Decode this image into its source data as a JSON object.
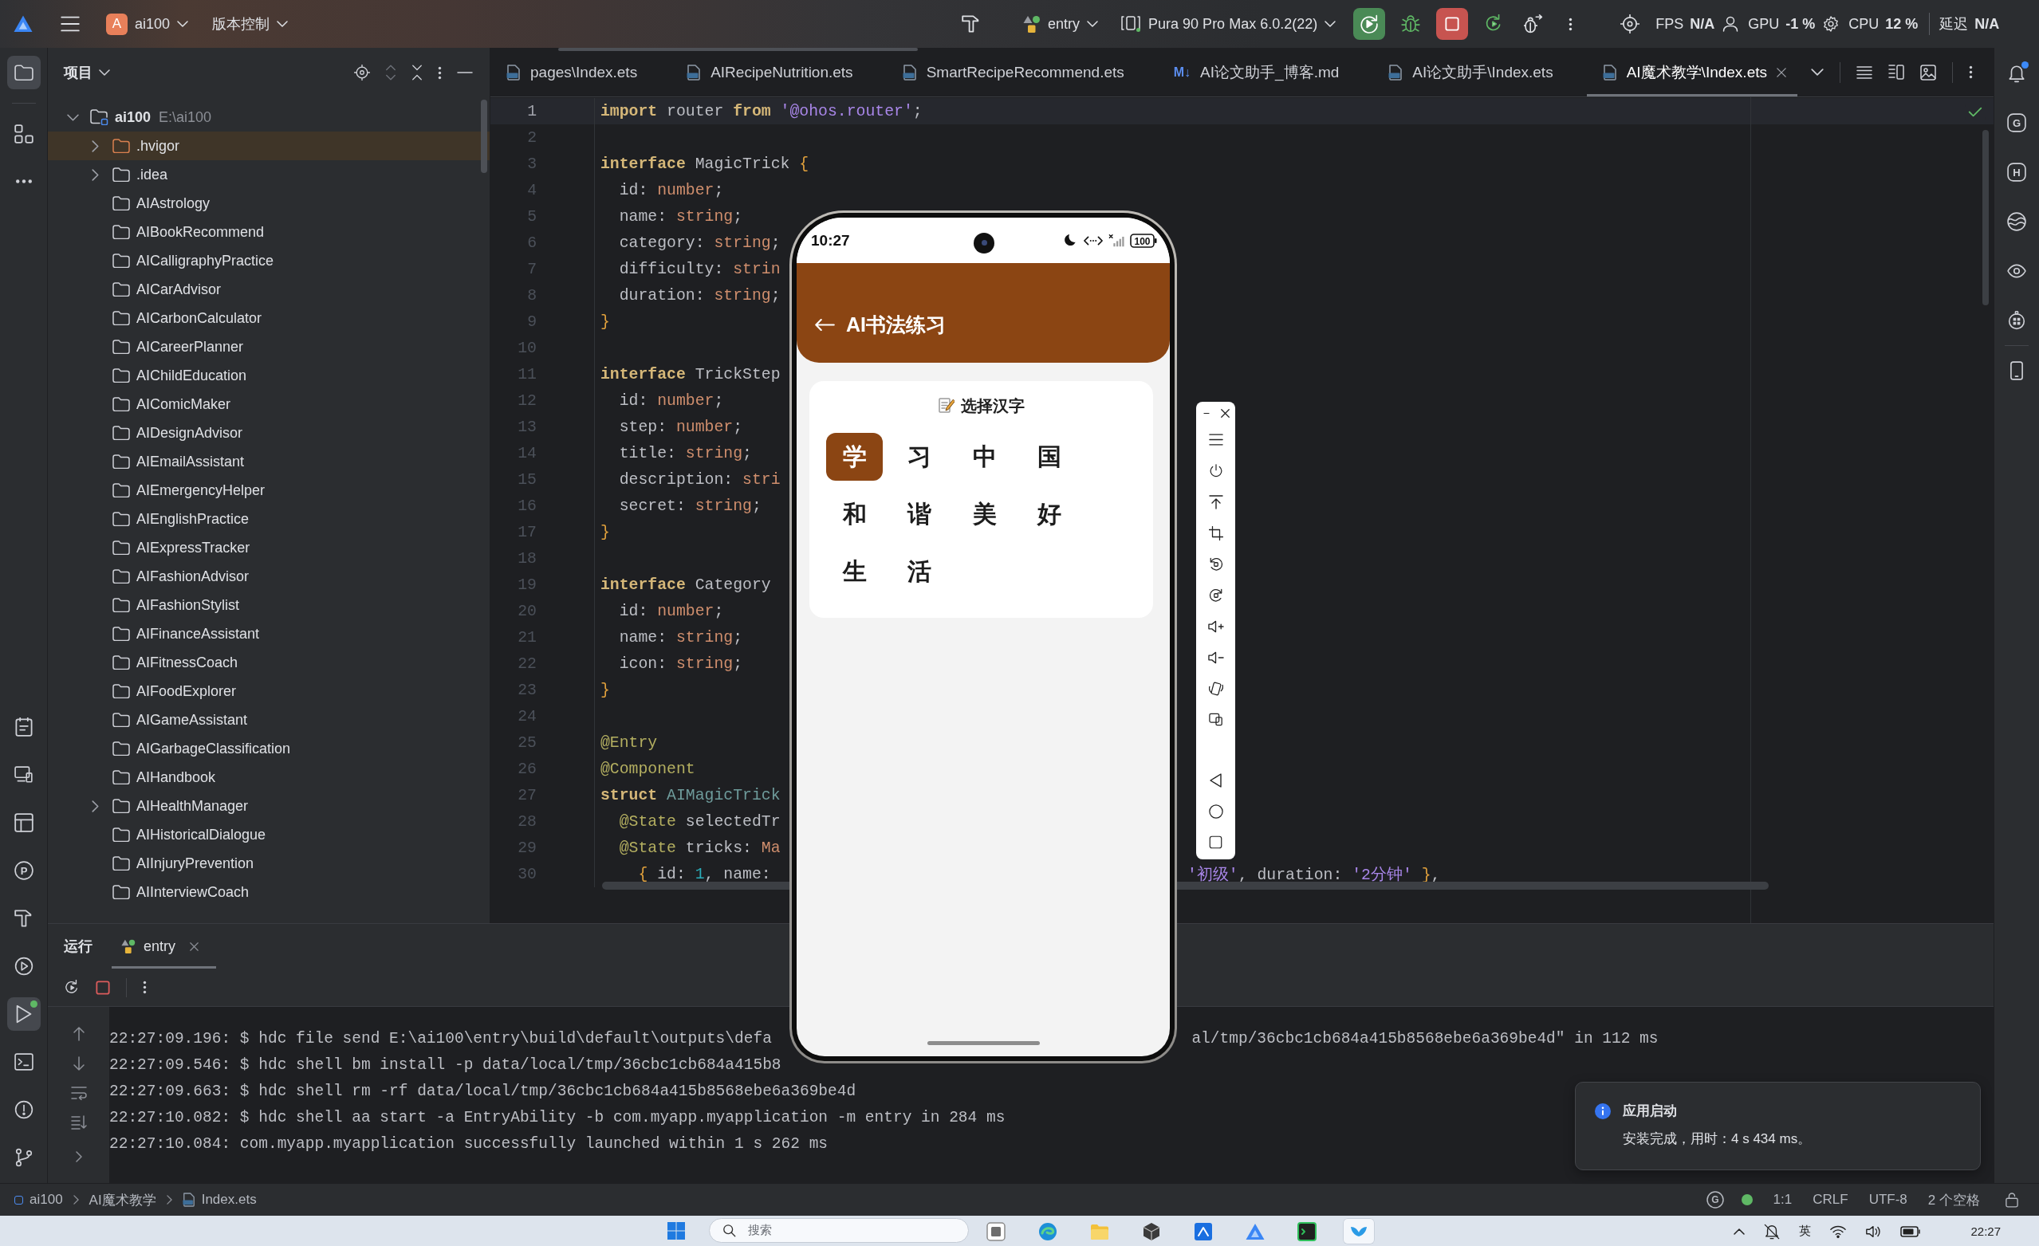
{
  "title_bar": {
    "project_badge": "A",
    "project_name": "ai100",
    "vcs_menu": "版本控制",
    "run_config": "entry",
    "device": "Pura 90 Pro Max 6.0.2(22)",
    "metrics": [
      {
        "label": "FPS",
        "value": "N/A"
      },
      {
        "label": "GPU",
        "value": "-1 %"
      },
      {
        "label": "CPU",
        "value": "12 %"
      },
      {
        "label": "延迟",
        "value": "N/A"
      }
    ]
  },
  "activity_bar": {
    "top": [
      {
        "kind": "project",
        "selected": true
      },
      {
        "kind": "structure",
        "selected": false
      },
      {
        "kind": "more",
        "selected": false
      }
    ],
    "bottom": [
      {
        "kind": "todo",
        "selected": false,
        "running": false
      },
      {
        "kind": "devices",
        "selected": false,
        "running": false
      },
      {
        "kind": "layout",
        "selected": false,
        "running": false
      },
      {
        "kind": "letter",
        "glyph": "P",
        "selected": false,
        "running": false
      },
      {
        "kind": "build",
        "selected": false,
        "running": false
      },
      {
        "kind": "services",
        "selected": false,
        "running": false
      },
      {
        "kind": "run",
        "selected": true,
        "running": true
      },
      {
        "kind": "terminal",
        "selected": false,
        "running": false
      },
      {
        "kind": "problems",
        "selected": false,
        "running": false
      },
      {
        "kind": "git",
        "selected": false,
        "running": false
      }
    ]
  },
  "project_panel": {
    "title": "项目",
    "tree": [
      {
        "name": "ai100",
        "path": "E:\\ai100",
        "kind": "module",
        "expanded": true,
        "selected": false,
        "children": [
          {
            "name": ".hvigor",
            "kind": "excluded",
            "expanded": false,
            "selected": true
          },
          {
            "name": ".idea",
            "kind": "folder",
            "expanded": false,
            "selected": false
          },
          {
            "name": "AIAstrology",
            "kind": "folder",
            "selected": false
          },
          {
            "name": "AIBookRecommend",
            "kind": "folder",
            "selected": false
          },
          {
            "name": "AICalligraphyPractice",
            "kind": "folder",
            "selected": false
          },
          {
            "name": "AICarAdvisor",
            "kind": "folder",
            "selected": false
          },
          {
            "name": "AICarbonCalculator",
            "kind": "folder",
            "selected": false
          },
          {
            "name": "AICareerPlanner",
            "kind": "folder",
            "selected": false
          },
          {
            "name": "AIChildEducation",
            "kind": "folder",
            "selected": false
          },
          {
            "name": "AIComicMaker",
            "kind": "folder",
            "selected": false
          },
          {
            "name": "AIDesignAdvisor",
            "kind": "folder",
            "selected": false
          },
          {
            "name": "AIEmailAssistant",
            "kind": "folder",
            "selected": false
          },
          {
            "name": "AIEmergencyHelper",
            "kind": "folder",
            "selected": false
          },
          {
            "name": "AIEnglishPractice",
            "kind": "folder",
            "selected": false
          },
          {
            "name": "AIExpressTracker",
            "kind": "folder",
            "selected": false
          },
          {
            "name": "AIFashionAdvisor",
            "kind": "folder",
            "selected": false
          },
          {
            "name": "AIFashionStylist",
            "kind": "folder",
            "selected": false
          },
          {
            "name": "AIFinanceAssistant",
            "kind": "folder",
            "selected": false
          },
          {
            "name": "AIFitnessCoach",
            "kind": "folder",
            "selected": false
          },
          {
            "name": "AIFoodExplorer",
            "kind": "folder",
            "selected": false
          },
          {
            "name": "AIGameAssistant",
            "kind": "folder",
            "selected": false
          },
          {
            "name": "AIGarbageClassification",
            "kind": "folder",
            "selected": false
          },
          {
            "name": "AIHandbook",
            "kind": "folder",
            "selected": false
          },
          {
            "name": "AIHealthManager",
            "kind": "folder",
            "expanded": false,
            "selected": false
          },
          {
            "name": "AIHistoricalDialogue",
            "kind": "folder",
            "selected": false
          },
          {
            "name": "AIInjuryPrevention",
            "kind": "folder",
            "selected": false
          },
          {
            "name": "AIInterviewCoach",
            "kind": "folder",
            "selected": false
          }
        ]
      }
    ]
  },
  "editor": {
    "tabs": [
      {
        "label": "pages\\Index.ets",
        "kind": "ets",
        "selected": false
      },
      {
        "label": "AIRecipeNutrition.ets",
        "kind": "ets",
        "selected": false
      },
      {
        "label": "SmartRecipeRecommend.ets",
        "kind": "ets",
        "selected": false
      },
      {
        "label": "AI论文助手_博客.md",
        "kind": "md",
        "icon_text": "M↓",
        "selected": false
      },
      {
        "label": "AI论文助手\\Index.ets",
        "kind": "ets",
        "selected": false
      },
      {
        "label": "AI魔术教学\\Index.ets",
        "kind": "ets",
        "selected": true
      }
    ],
    "no_problems": true,
    "lines": [
      {
        "number": "1",
        "current": true,
        "tokens": [
          {
            "kind": "kw",
            "text": "import"
          },
          {
            "kind": "plain",
            "text": " router "
          },
          {
            "kind": "kw",
            "text": "from"
          },
          {
            "kind": "str",
            "text": " '@ohos.router'"
          },
          {
            "kind": "plain",
            "text": ";"
          }
        ]
      },
      {
        "number": "2",
        "current": false
      },
      {
        "number": "3",
        "current": false,
        "tokens": [
          {
            "kind": "kw",
            "text": "interface"
          },
          {
            "kind": "cls",
            "text": " MagicTrick"
          },
          {
            "kind": "brace",
            "text": " {"
          }
        ]
      },
      {
        "number": "4",
        "current": false,
        "tokens": [
          {
            "kind": "plain",
            "text": "  id: "
          },
          {
            "kind": "type",
            "text": "number"
          },
          {
            "kind": "plain",
            "text": ";"
          }
        ]
      },
      {
        "number": "5",
        "current": false,
        "tokens": [
          {
            "kind": "plain",
            "text": "  name: "
          },
          {
            "kind": "type",
            "text": "string"
          },
          {
            "kind": "plain",
            "text": ";"
          }
        ]
      },
      {
        "number": "6",
        "current": false,
        "tokens": [
          {
            "kind": "plain",
            "text": "  category: "
          },
          {
            "kind": "type",
            "text": "string"
          },
          {
            "kind": "plain",
            "text": ";"
          }
        ]
      },
      {
        "number": "7",
        "current": false,
        "tokens": [
          {
            "kind": "plain",
            "text": "  difficulty: "
          },
          {
            "kind": "type",
            "text": "strin"
          }
        ]
      },
      {
        "number": "8",
        "current": false,
        "tokens": [
          {
            "kind": "plain",
            "text": "  duration: "
          },
          {
            "kind": "type",
            "text": "string"
          },
          {
            "kind": "plain",
            "text": ";"
          }
        ]
      },
      {
        "number": "9",
        "current": false,
        "tokens": [
          {
            "kind": "brace",
            "text": "}"
          }
        ]
      },
      {
        "number": "10",
        "current": false
      },
      {
        "number": "11",
        "current": false,
        "tokens": [
          {
            "kind": "kw",
            "text": "interface"
          },
          {
            "kind": "cls",
            "text": " TrickStep"
          }
        ]
      },
      {
        "number": "12",
        "current": false,
        "tokens": [
          {
            "kind": "plain",
            "text": "  id: "
          },
          {
            "kind": "type",
            "text": "number"
          },
          {
            "kind": "plain",
            "text": ";"
          }
        ]
      },
      {
        "number": "13",
        "current": false,
        "tokens": [
          {
            "kind": "plain",
            "text": "  step: "
          },
          {
            "kind": "type",
            "text": "number"
          },
          {
            "kind": "plain",
            "text": ";"
          }
        ]
      },
      {
        "number": "14",
        "current": false,
        "tokens": [
          {
            "kind": "plain",
            "text": "  title: "
          },
          {
            "kind": "type",
            "text": "string"
          },
          {
            "kind": "plain",
            "text": ";"
          }
        ]
      },
      {
        "number": "15",
        "current": false,
        "tokens": [
          {
            "kind": "plain",
            "text": "  description: "
          },
          {
            "kind": "type",
            "text": "stri"
          }
        ]
      },
      {
        "number": "16",
        "current": false,
        "tokens": [
          {
            "kind": "plain",
            "text": "  secret: "
          },
          {
            "kind": "type",
            "text": "string"
          },
          {
            "kind": "plain",
            "text": ";"
          }
        ]
      },
      {
        "number": "17",
        "current": false,
        "tokens": [
          {
            "kind": "brace",
            "text": "}"
          }
        ]
      },
      {
        "number": "18",
        "current": false
      },
      {
        "number": "19",
        "current": false,
        "tokens": [
          {
            "kind": "kw",
            "text": "interface"
          },
          {
            "kind": "cls",
            "text": " Category"
          }
        ]
      },
      {
        "number": "20",
        "current": false,
        "tokens": [
          {
            "kind": "plain",
            "text": "  id: "
          },
          {
            "kind": "type",
            "text": "number"
          },
          {
            "kind": "plain",
            "text": ";"
          }
        ]
      },
      {
        "number": "21",
        "current": false,
        "tokens": [
          {
            "kind": "plain",
            "text": "  name: "
          },
          {
            "kind": "type",
            "text": "string"
          },
          {
            "kind": "plain",
            "text": ";"
          }
        ]
      },
      {
        "number": "22",
        "current": false,
        "tokens": [
          {
            "kind": "plain",
            "text": "  icon: "
          },
          {
            "kind": "type",
            "text": "string"
          },
          {
            "kind": "plain",
            "text": ";"
          }
        ]
      },
      {
        "number": "23",
        "current": false,
        "tokens": [
          {
            "kind": "brace",
            "text": "}"
          }
        ]
      },
      {
        "number": "24",
        "current": false
      },
      {
        "number": "25",
        "current": false,
        "tokens": [
          {
            "kind": "deco",
            "text": "@Entry"
          }
        ]
      },
      {
        "number": "26",
        "current": false,
        "tokens": [
          {
            "kind": "deco",
            "text": "@Component"
          }
        ]
      },
      {
        "number": "27",
        "current": false,
        "tokens": [
          {
            "kind": "kw",
            "text": "struct"
          },
          {
            "kind": "struct",
            "text": " AIMagicTrick"
          }
        ]
      },
      {
        "number": "28",
        "current": false,
        "tokens": [
          {
            "kind": "deco",
            "text": "  @State"
          },
          {
            "kind": "plain",
            "text": " selectedTr"
          }
        ]
      },
      {
        "number": "29",
        "current": false,
        "tokens": [
          {
            "kind": "deco",
            "text": "  @State"
          },
          {
            "kind": "plain",
            "text": " tricks: "
          },
          {
            "kind": "type",
            "text": "Ma"
          }
        ]
      },
      {
        "number": "30",
        "current": false,
        "tokens": [
          {
            "kind": "brace",
            "text": "    {"
          },
          {
            "kind": "plain",
            "text": " id: "
          },
          {
            "kind": "num",
            "text": "1"
          },
          {
            "kind": "plain",
            "text": ", name:"
          }
        ],
        "visible_end": [
          {
            "kind": "str",
            "text": "'初级'"
          },
          {
            "kind": "plain",
            "text": ", duration: "
          },
          {
            "kind": "str",
            "text": "'2分钟'"
          },
          {
            "kind": "brace",
            "text": " }"
          },
          {
            "kind": "plain",
            "text": ","
          }
        ]
      }
    ]
  },
  "right_bar": {
    "items": [
      {
        "kind": "bell",
        "badge": true
      },
      {
        "kind": "letter",
        "glyph": "G",
        "badge": false
      },
      {
        "kind": "letter",
        "glyph": "H",
        "badge": false
      },
      {
        "kind": "wave",
        "badge": false
      },
      {
        "kind": "eye",
        "badge": false
      },
      {
        "kind": "robot",
        "badge": false
      },
      {
        "kind": "phone",
        "badge": false
      }
    ]
  },
  "run_panel": {
    "title": "运行",
    "tabs": [
      {
        "label": "entry",
        "selected": true
      }
    ],
    "log": [
      {
        "text": "22:27:09.196: $ hdc file send E:\\ai100\\entry\\build\\default\\outputs\\defa",
        "visible_end": "al/tmp/36cbc1cb684a415b8568ebe6a369be4d\" in 112 ms"
      },
      {
        "text": "22:27:09.546: $ hdc shell bm install -p data/local/tmp/36cbc1cb684a415b8"
      },
      {
        "text": "22:27:09.663: $ hdc shell rm -rf data/local/tmp/36cbc1cb684a415b8568ebe6a369be4d"
      },
      {
        "text": "22:27:10.082: $ hdc shell aa start -a EntryAbility -b com.myapp.myapplication -m entry in 284 ms"
      },
      {
        "text": "22:27:10.084: com.myapp.myapplication successfully launched within 1 s 262 ms"
      }
    ]
  },
  "notification": {
    "title": "应用启动",
    "message": "安装完成，用时：4 s 434 ms。"
  },
  "status_bar": {
    "breadcrumbs": [
      {
        "label": "ai100",
        "kind": "module"
      },
      {
        "label": "AI魔术教学",
        "kind": "plain"
      },
      {
        "label": "Index.ets",
        "kind": "ets"
      }
    ],
    "widget_glyph": "G",
    "connected": true,
    "items": [
      "1:1",
      "CRLF",
      "UTF-8",
      "2 个空格"
    ]
  },
  "emulator": {
    "time": "10:27",
    "battery": "100",
    "app_title": "AI书法练习",
    "card_title": "选择汉字",
    "characters": [
      {
        "char": "学",
        "selected": true
      },
      {
        "char": "习",
        "selected": false
      },
      {
        "char": "中",
        "selected": false
      },
      {
        "char": "国",
        "selected": false
      },
      {
        "char": "和",
        "selected": false
      },
      {
        "char": "谐",
        "selected": false
      },
      {
        "char": "美",
        "selected": false
      },
      {
        "char": "好",
        "selected": false
      },
      {
        "char": "生",
        "selected": false
      },
      {
        "char": "活",
        "selected": false
      }
    ]
  },
  "taskbar": {
    "search_placeholder": "搜索",
    "apps": [
      {
        "kind": "widgets",
        "active": false
      },
      {
        "kind": "browser",
        "active": false
      },
      {
        "kind": "files",
        "active": false
      },
      {
        "kind": "cube",
        "active": false
      },
      {
        "kind": "tile",
        "active": false
      },
      {
        "kind": "triangle",
        "active": false
      },
      {
        "kind": "terminal",
        "active": false
      },
      {
        "kind": "bird",
        "active": true
      }
    ],
    "input_method": "英",
    "clock": "22:27"
  }
}
